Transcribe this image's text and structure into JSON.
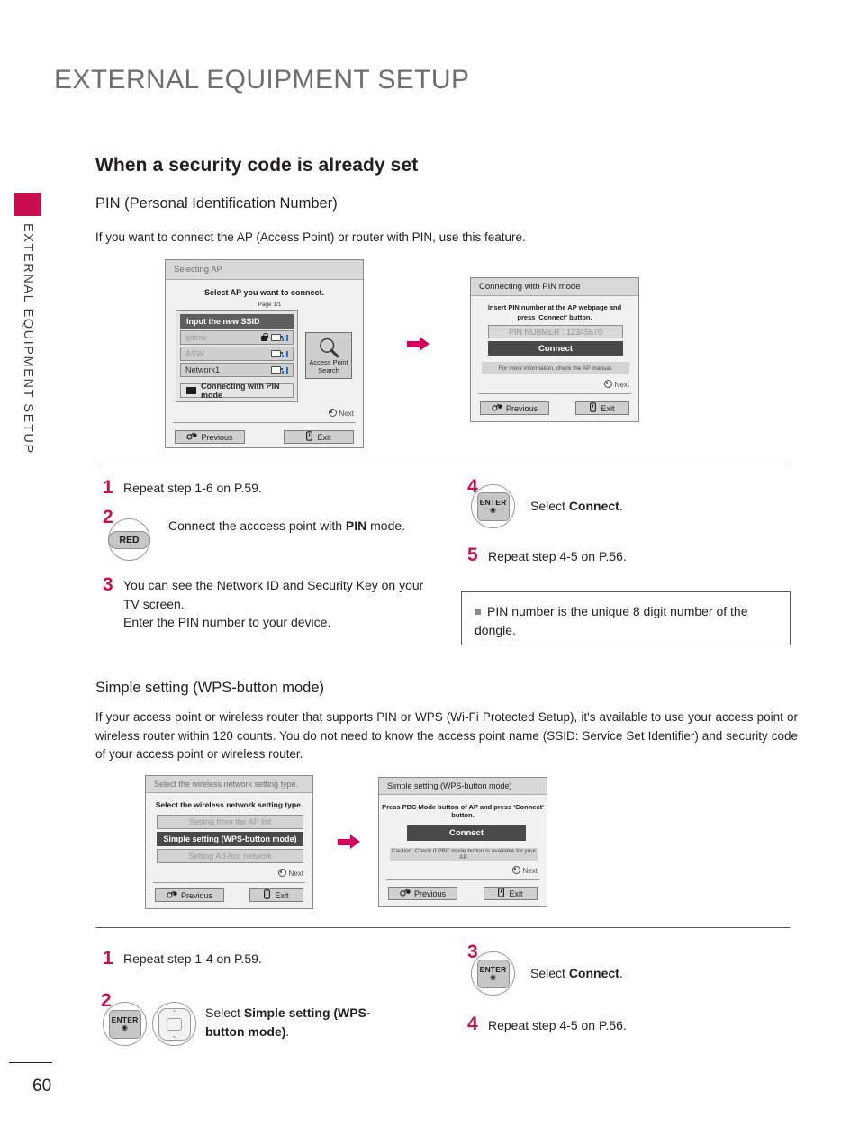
{
  "document": {
    "title": "EXTERNAL EQUIPMENT SETUP",
    "sidebar_label": "EXTERNAL EQUIPMENT SETUP",
    "page_number": "60"
  },
  "section": {
    "heading": "When a security code is already set",
    "subheading": "PIN (Personal Identification Number)",
    "intro": "If you want to connect the AP (Access Point) or router with PIN, use this feature."
  },
  "screen_selecting_ap": {
    "title": "Selecting AP",
    "subtitle": "Select AP you want to connect.",
    "page_indicator": "Page 1/1",
    "items": [
      {
        "label": "Input the new SSID",
        "state": "selected",
        "lock": false,
        "signal": false
      },
      {
        "label": "iptime",
        "state": "dim",
        "lock": true,
        "signal": true
      },
      {
        "label": "ASW",
        "state": "dim",
        "lock": false,
        "signal": true
      },
      {
        "label": "Network1",
        "state": "normal",
        "lock": false,
        "signal": true
      }
    ],
    "pin_row_label": "Connecting with PIN mode",
    "ap_search_label_1": "Access Point",
    "ap_search_label_2": "Search",
    "next_label": "Next",
    "previous_label": "Previous",
    "exit_label": "Exit"
  },
  "screen_pin_mode": {
    "title": "Connecting with PIN mode",
    "instruction_line1": "Insert PIN number at the AP webpage and",
    "instruction_line2": "press 'Connect' button.",
    "pin_field": "PIN NUBMER : 12345670",
    "connect_label": "Connect",
    "info_note": "For more information, check the AP manual.",
    "next_label": "Next",
    "previous_label": "Previous",
    "exit_label": "Exit"
  },
  "steps_pin": {
    "left": [
      {
        "num": "1",
        "text": "Repeat step 1-6 on P.59."
      },
      {
        "num": "2",
        "key": "RED",
        "text_before": "Connect the acccess point with ",
        "bold": "PIN",
        "text_after": " mode."
      },
      {
        "num": "3",
        "text": "You can see the Network ID and Security Key on your TV screen.",
        "text2": "Enter the PIN number to your device."
      }
    ],
    "right": [
      {
        "num": "4",
        "key": "ENTER",
        "text_before": "Select ",
        "bold": "Connect",
        "text_after": "."
      },
      {
        "num": "5",
        "text": "Repeat step 4-5 on P.56."
      }
    ],
    "note": "PIN number is the unique 8 digit number of the dongle."
  },
  "section_wps": {
    "heading": "Simple setting (WPS-button mode)",
    "intro": "If your access point or wireless router that supports PIN or WPS (Wi-Fi Protected Setup), it's available to use your access point or wireless router within 120 counts. You do not need to know the access point name (SSID: Service Set Identifier) and security code of your access point or wireless router."
  },
  "screen_network_type": {
    "title": "Select the wireless network setting type.",
    "subtitle": "Select the wireless network setting type.",
    "items": [
      {
        "label": "Setting from the AP list",
        "state": "dim"
      },
      {
        "label": "Simple setting (WPS-button mode)",
        "state": "selected"
      },
      {
        "label": "Setting Ad-hoc network",
        "state": "dim"
      }
    ],
    "next_label": "Next",
    "previous_label": "Previous",
    "exit_label": "Exit"
  },
  "screen_wps": {
    "title": "Simple setting (WPS-button mode)",
    "instruction": "Press PBC Mode button of AP and press 'Connect' button.",
    "connect_label": "Connect",
    "caution": "Caution: Check if PBC mode button is available for your AP.",
    "next_label": "Next",
    "previous_label": "Previous",
    "exit_label": "Exit"
  },
  "steps_wps": {
    "left": [
      {
        "num": "1",
        "text": "Repeat step 1-4 on P.59."
      },
      {
        "num": "2",
        "key_enter": "ENTER",
        "text_before": "Select ",
        "bold1": "Simple setting (WPS-",
        "bold2": "button mode)",
        "text_after": "."
      }
    ],
    "right": [
      {
        "num": "3",
        "key": "ENTER",
        "text_before": "Select ",
        "bold": "Connect",
        "text_after": "."
      },
      {
        "num": "4",
        "text": "Repeat step 4-5 on P.56."
      }
    ]
  },
  "icons": {
    "previous": "↻",
    "exit": "▯",
    "enter_mark": "◉",
    "next_dot": "◉"
  },
  "colors": {
    "brand_magenta": "#c80d4e",
    "step_number": "#c8104f",
    "arrow": "#d6005a",
    "title_gray": "#6d6e71"
  }
}
